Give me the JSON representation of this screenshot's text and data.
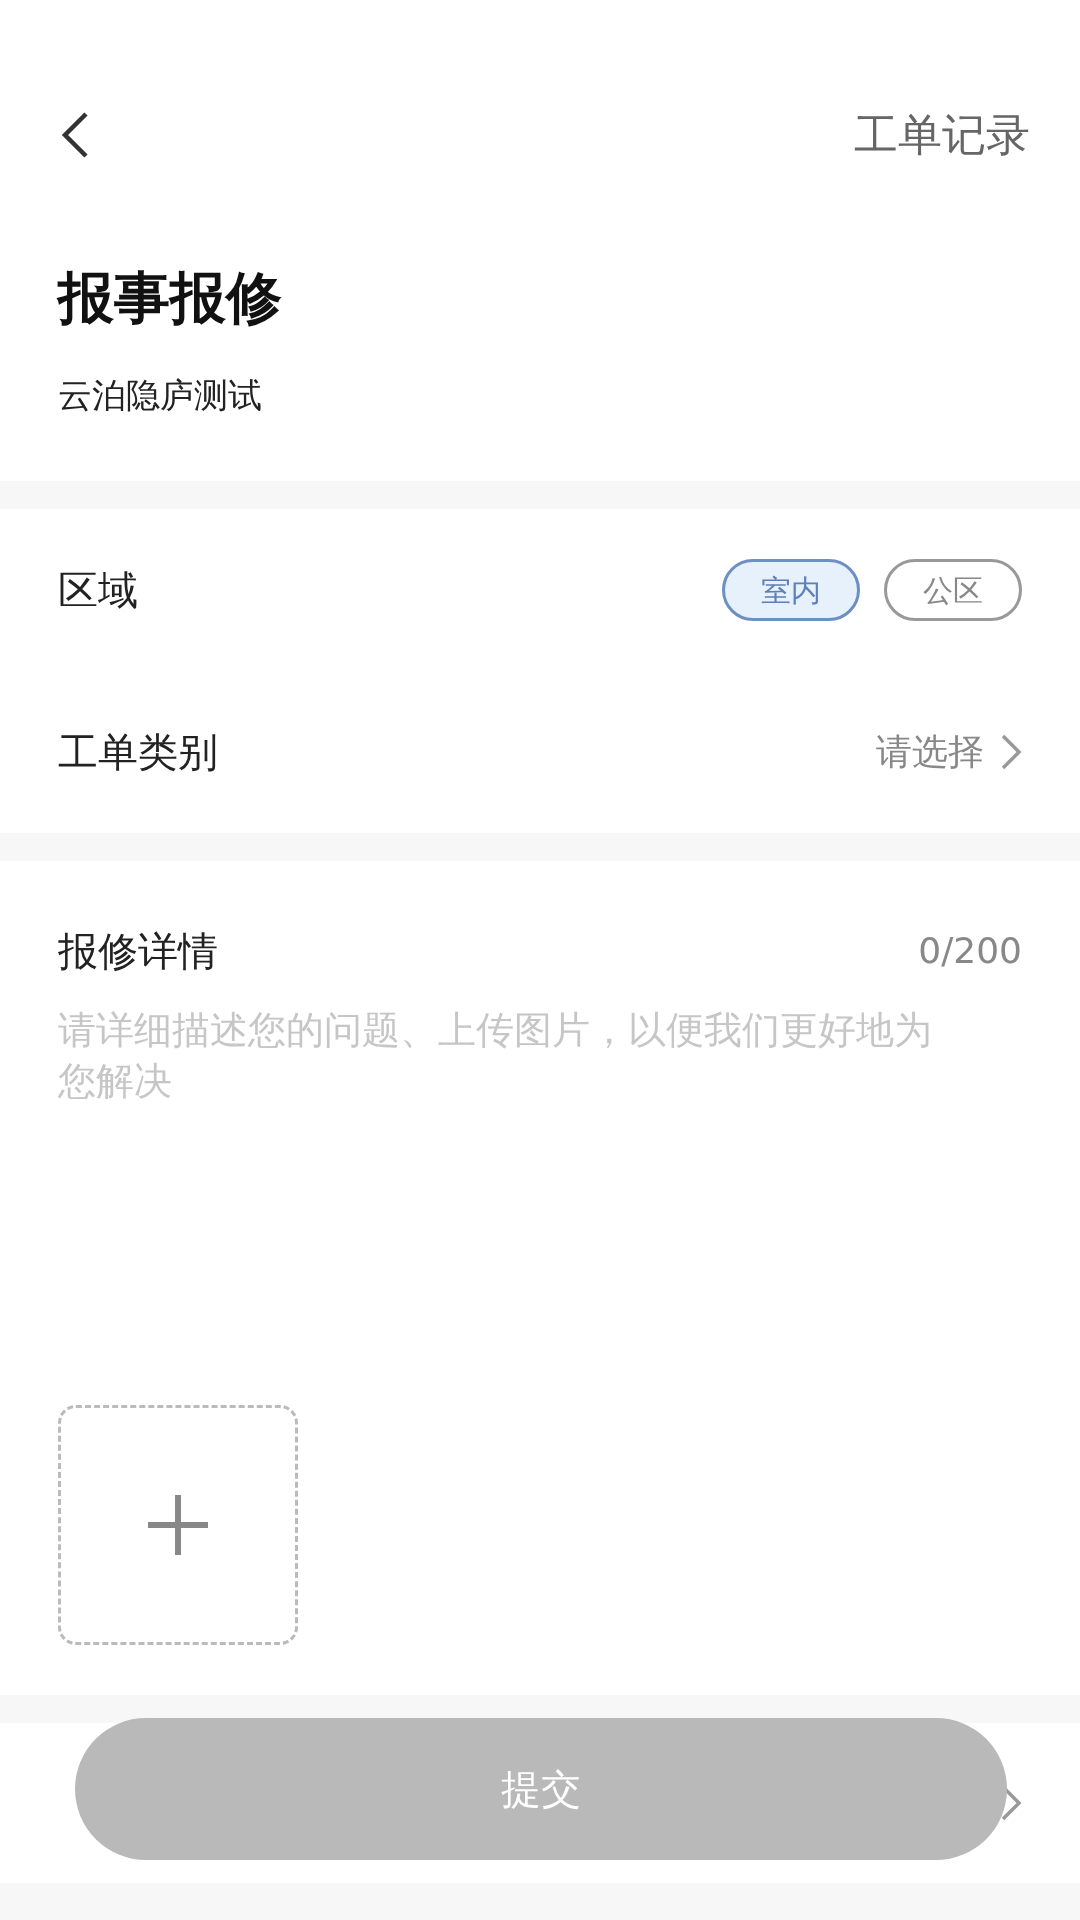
{
  "header": {
    "action": "工单记录"
  },
  "title": "报事报修",
  "subtitle": "云泊隐庐测试",
  "area": {
    "label": "区域",
    "options": [
      {
        "label": "室内",
        "selected": true
      },
      {
        "label": "公区",
        "selected": false
      }
    ]
  },
  "category": {
    "label": "工单类别",
    "value": "请选择"
  },
  "details": {
    "label": "报修详情",
    "counter": "0/200",
    "placeholder": "请详细描述您的问题、上传图片，以便我们更好地为您解决"
  },
  "submit": {
    "label": "提交",
    "disabled": true
  }
}
